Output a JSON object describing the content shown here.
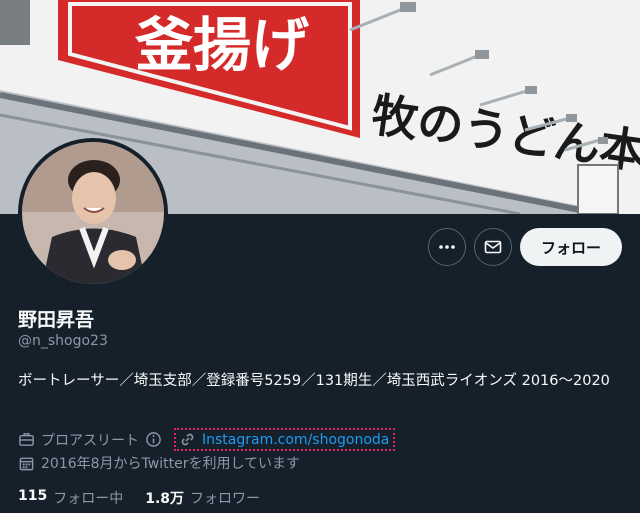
{
  "banner": {
    "sign_left": "釜揚げ",
    "sign_right": "牧のうどん本店"
  },
  "profile": {
    "display_name": "野田昇吾",
    "handle": "@n_shogo23",
    "bio": "ボートレーサー／埼玉支部／登録番号5259／131期生／埼玉西武ライオンズ 2016〜2020",
    "category": "プロアスリート",
    "link": "Instagram.com/shogonoda",
    "joined": "2016年8月からTwitterを利用しています"
  },
  "actions": {
    "follow_label": "フォロー",
    "more_icon": "ellipsis-icon",
    "message_icon": "envelope-icon"
  },
  "stats": {
    "following_count": "115",
    "following_label": "フォロー中",
    "followers_count": "1.8万",
    "followers_label": "フォロワー"
  },
  "colors": {
    "background": "#15202b",
    "link": "#1d9bf0",
    "muted": "#8b98a5",
    "sign_red": "#d42a2a"
  }
}
